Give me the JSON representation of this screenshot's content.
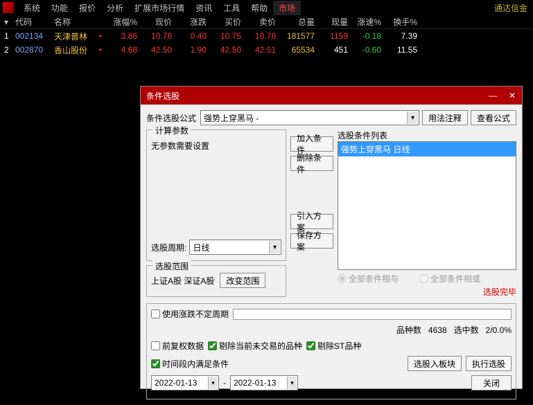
{
  "brand": "通达信金",
  "menu": [
    "系统",
    "功能",
    "报价",
    "分析",
    "扩展市场行情",
    "资讯",
    "工具",
    "帮助",
    "市场"
  ],
  "menu_active_index": 8,
  "columns": [
    "",
    "代码",
    "名称",
    "",
    "涨幅%",
    "现价",
    "涨跌",
    "买价",
    "卖价",
    "总量",
    "现量",
    "涨速%",
    "换手%"
  ],
  "rows": [
    {
      "idx": "1",
      "code": "002134",
      "name": "天津普林",
      "pct": "3.86",
      "price": "10.76",
      "chg": "0.40",
      "bid": "10.75",
      "ask": "10.76",
      "vol": "181577",
      "cur": "1159",
      "spd": "-0.18",
      "turn": "7.39"
    },
    {
      "idx": "2",
      "code": "002870",
      "name": "香山股份",
      "pct": "4.68",
      "price": "42.50",
      "chg": "1.90",
      "bid": "42.50",
      "ask": "42.51",
      "vol": "65534",
      "cur": "451",
      "spd": "-0.60",
      "turn": "11.55"
    }
  ],
  "dialog": {
    "title": "条件选股",
    "formula_label": "条件选股公式",
    "formula_value": "强势上穿黑马 -",
    "btn_usage": "用法注释",
    "btn_view": "查看公式",
    "gb_calc_title": "计算参数",
    "noparam": "无参数需要设置",
    "period_label": "选股周期:",
    "period_value": "日线",
    "gb_scope_title": "选股范围",
    "scope_text": "上证A股 深证A股",
    "btn_change_scope": "改变范围",
    "btn_add": "加入条件",
    "btn_del": "删除条件",
    "btn_import": "引入方案",
    "btn_save": "保存方案",
    "list_title": "选股条件列表",
    "list_item": "强势上穿黑马  日线",
    "radio_all_and": "全部条件相与",
    "radio_all_or": "全部条件相或",
    "status_done": "选股完毕",
    "cb_use_period": "使用涨跌不定周期",
    "count_label": "品种数",
    "count_value": "4638",
    "selected_label": "选中数",
    "selected_value": "2/0.0%",
    "cb_fuquan": "前复权数据",
    "cb_exclude_notrade": "剔除当前未交易的品种",
    "cb_exclude_st": "剔除ST品种",
    "cb_time_range": "时间段内满足条件",
    "btn_into_block": "选股入板块",
    "btn_exec": "执行选股",
    "date_from": "2022-01-13",
    "date_to": "2022-01-13",
    "date_sep": "-",
    "btn_close": "关闭"
  }
}
